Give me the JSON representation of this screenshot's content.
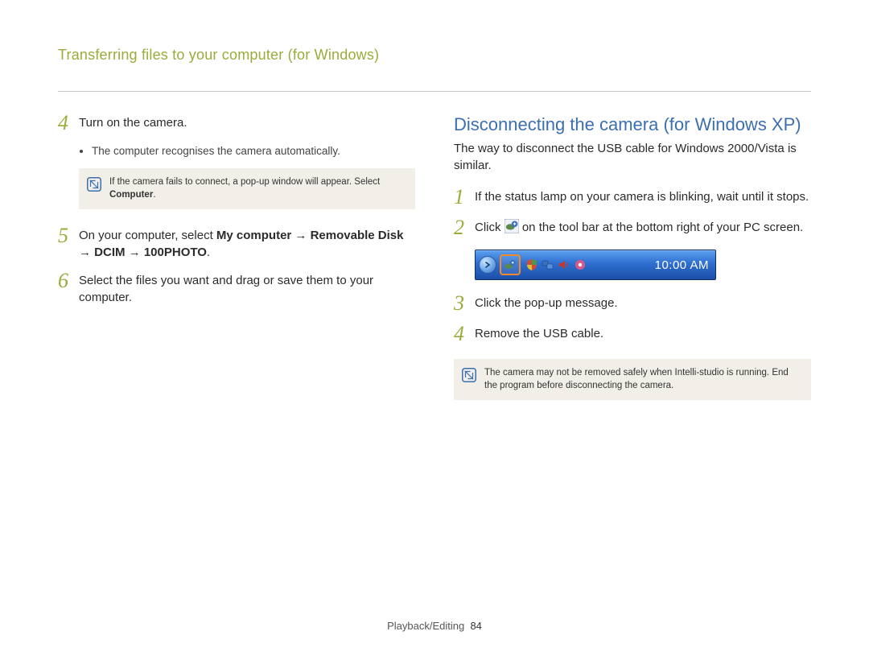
{
  "header": {
    "title": "Transferring files to your computer (for Windows)"
  },
  "left": {
    "steps": [
      {
        "num": "4",
        "text": "Turn on the camera."
      },
      {
        "num": "5",
        "text_pre": "On your computer, select ",
        "bold": "My computer → Removable Disk → DCIM → 100PHOTO",
        "text_post": "."
      },
      {
        "num": "6",
        "text": "Select the files you want and drag or save them to your computer."
      }
    ],
    "sub_bullet": "The computer recognises the camera automatically.",
    "note": {
      "text_pre": "If the camera fails to connect, a pop-up window will appear. Select ",
      "bold": "Computer",
      "text_post": "."
    }
  },
  "right": {
    "heading": "Disconnecting the camera (for Windows XP)",
    "intro": "The way to disconnect the USB cable for Windows 2000/Vista is similar.",
    "steps": [
      {
        "num": "1",
        "text": "If the status lamp on your camera is blinking, wait until it stops."
      },
      {
        "num": "2",
        "text_pre": "Click ",
        "text_post": " on the tool bar at the bottom right of your PC screen."
      },
      {
        "num": "3",
        "text": "Click the pop-up message."
      },
      {
        "num": "4",
        "text": "Remove the USB cable."
      }
    ],
    "taskbar": {
      "clock": "10:00 AM"
    },
    "note": {
      "text": "The camera may not be removed safely when Intelli-studio is running. End the program before disconnecting the camera."
    }
  },
  "footer": {
    "section": "Playback/Editing",
    "page": "84"
  }
}
